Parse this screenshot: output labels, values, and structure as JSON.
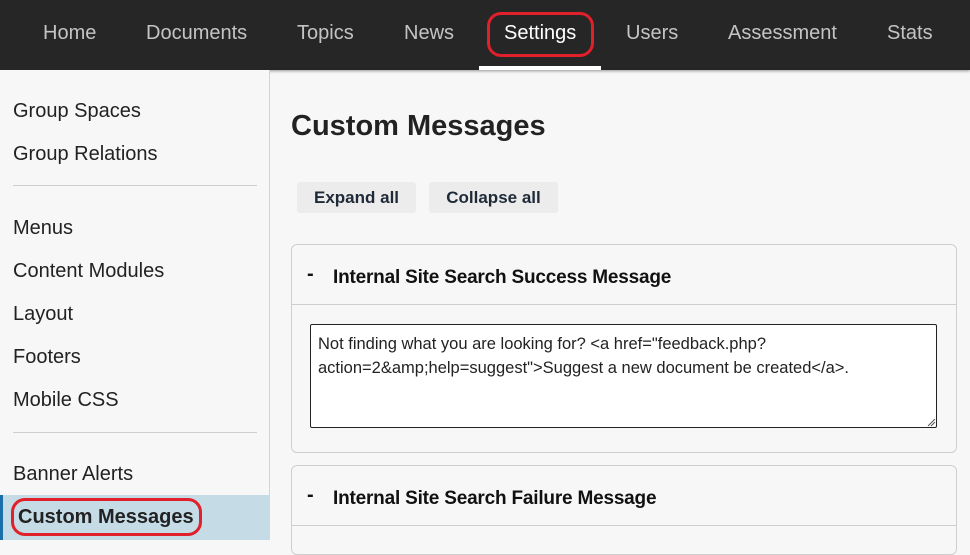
{
  "topnav": {
    "items": [
      {
        "label": "Home"
      },
      {
        "label": "Documents"
      },
      {
        "label": "Topics"
      },
      {
        "label": "News"
      },
      {
        "label": "Settings",
        "active": true
      },
      {
        "label": "Users"
      },
      {
        "label": "Assessment"
      },
      {
        "label": "Stats"
      }
    ]
  },
  "sidebar": {
    "groups": [
      [
        "Group Spaces",
        "Group Relations"
      ],
      [
        "Menus",
        "Content Modules",
        "Layout",
        "Footers",
        "Mobile CSS"
      ],
      [
        "Banner Alerts",
        "Custom Messages"
      ]
    ],
    "active": "Custom Messages"
  },
  "main": {
    "title": "Custom Messages",
    "expand_label": "Expand all",
    "collapse_label": "Collapse all",
    "panels": [
      {
        "toggle": "-",
        "title": "Internal Site Search Success Message",
        "value": "Not finding what you are looking for? <a href=\"feedback.php?action=2&amp;help=suggest\">Suggest a new document be created</a>."
      },
      {
        "toggle": "-",
        "title": "Internal Site Search Failure Message"
      }
    ]
  },
  "colors": {
    "nav_bg": "#262626",
    "highlight": "#e0202a",
    "sidebar_active_bg": "#c5dbe6",
    "sidebar_active_bar": "#1a6fa8"
  }
}
